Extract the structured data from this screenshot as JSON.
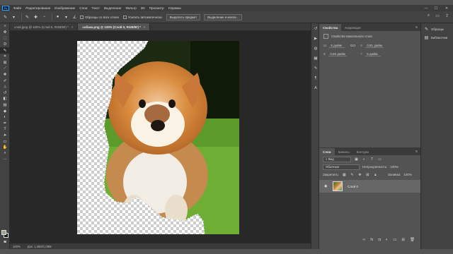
{
  "app": {
    "logo_text": "Ps",
    "menu": [
      "Файл",
      "Редактирование",
      "Изображение",
      "Слои",
      "Текст",
      "Выделение",
      "Фильтр",
      "3D",
      "Просмотр",
      "Справка"
    ],
    "window_controls": {
      "minimize": "—",
      "maximize": "☐",
      "close": "✕"
    }
  },
  "options_bar": {
    "sample_all_layers": "Образцы со всех слоев",
    "auto_enhance": "Усилить автоматически",
    "select_subject": "Выделить предмет",
    "select_and_mask": "Выделение и маска..."
  },
  "tabs": [
    {
      "label": "слой.jpeg @ 100% (Слой 0, RGB/8#) *",
      "close": "×"
    },
    {
      "label": "собака.png @ 100% (Слой 0, RGB/8#) *",
      "close": "×"
    }
  ],
  "status": {
    "zoom": "100%",
    "doc_info": "Док: 1,46М/1,08М"
  },
  "properties": {
    "tabs": [
      "Свойства",
      "Коррекция"
    ],
    "title": "Свойства пиксельного слоя",
    "w_label": "Ш",
    "w_value": "5 дюйм",
    "link": "GO",
    "x_label": "X",
    "x_value": "0,81 дюйм",
    "h_label": "В",
    "h_value": "0,69 дюйм",
    "y_label": "Y",
    "y_value": "5 дюйм"
  },
  "layers": {
    "tabs": [
      "Слои",
      "Каналы",
      "Контуры"
    ],
    "kind_filter": "Вид",
    "blend_mode": "Обычные",
    "opacity_label": "Непрозрачность:",
    "opacity_value": "100%",
    "lock_label": "Закрепить:",
    "fill_label": "Заливка:",
    "fill_value": "100%",
    "items": [
      {
        "name": "Слой 0"
      }
    ]
  },
  "side_panels": [
    {
      "icon": "brush-presets-icon",
      "label": "Образцы"
    },
    {
      "icon": "libraries-icon",
      "label": "Библиотеки"
    }
  ],
  "colors": {
    "foreground": "#9aa88a",
    "background": "#1a1a1a"
  }
}
